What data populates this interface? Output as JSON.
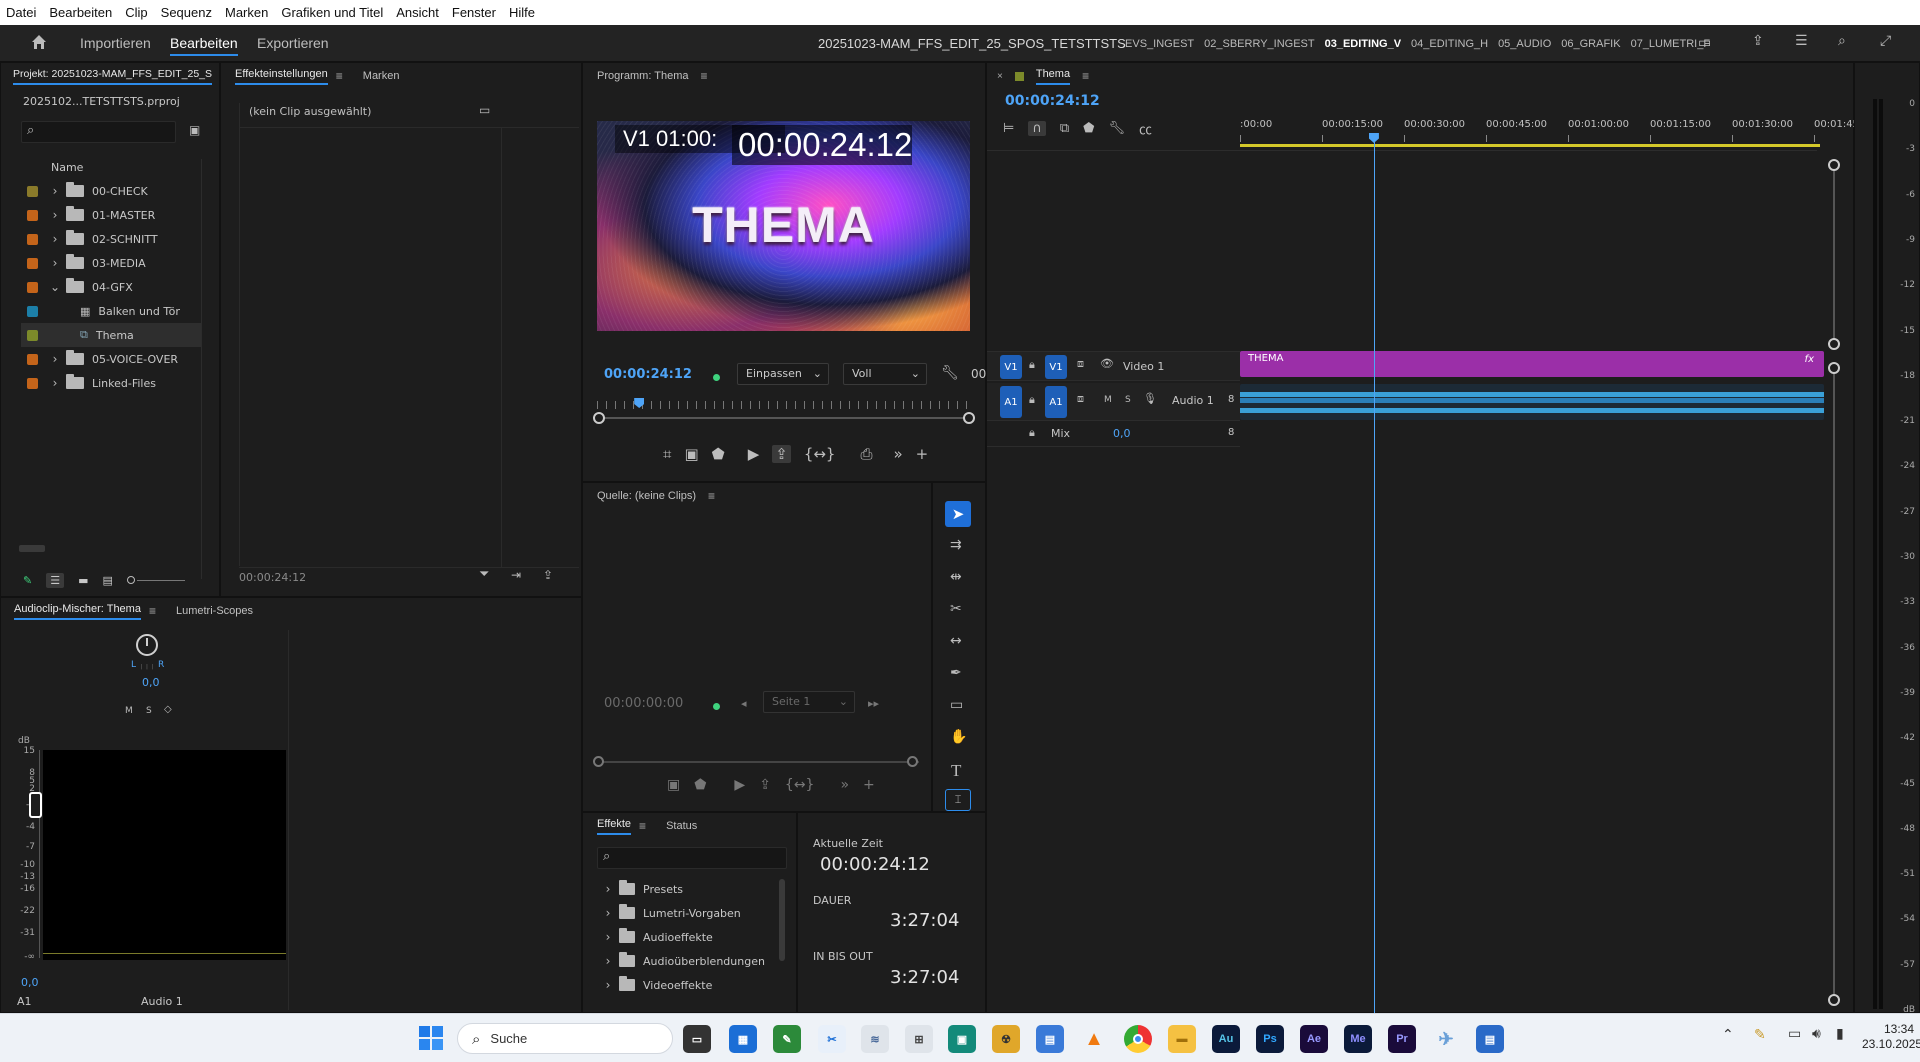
{
  "menu": [
    "Datei",
    "Bearbeiten",
    "Clip",
    "Sequenz",
    "Marken",
    "Grafiken und Titel",
    "Ansicht",
    "Fenster",
    "Hilfe"
  ],
  "workspace": {
    "buttons": [
      "Importieren",
      "Bearbeiten",
      "Exportieren"
    ],
    "active": "Bearbeiten",
    "sequence_title": "20251023-MAM_FFS_EDIT_25_SPOS_TETSTTSTS",
    "tabs": [
      ".EVS_INGEST",
      "02_SBERRY_INGEST",
      "03_EDITING_V",
      "04_EDITING_H",
      "05_AUDIO",
      "06_GRAFIK",
      "07_LUMETRI_F"
    ],
    "active_tab": "03_EDITING_V"
  },
  "project": {
    "title": "Projekt: 20251023-MAM_FFS_EDIT_25_S",
    "file": "2025102...TETSTTSTS.prproj",
    "column_name": "Name",
    "items": [
      {
        "label": "00-CHECK",
        "color": "#8a7a2a",
        "type": "folder",
        "expanded": false,
        "indent": 0
      },
      {
        "label": "01-MASTER",
        "color": "#c4641a",
        "type": "folder",
        "expanded": false,
        "indent": 0
      },
      {
        "label": "02-SCHNITT",
        "color": "#c4641a",
        "type": "folder",
        "expanded": false,
        "indent": 0
      },
      {
        "label": "03-MEDIA",
        "color": "#c4641a",
        "type": "folder",
        "expanded": false,
        "indent": 0
      },
      {
        "label": "04-GFX",
        "color": "#c4641a",
        "type": "folder",
        "expanded": true,
        "indent": 0
      },
      {
        "label": "Balken und Töne",
        "color": "#1c7fa8",
        "type": "bars",
        "expanded": false,
        "indent": 1
      },
      {
        "label": "Thema",
        "color": "#7c8a2a",
        "type": "sequence",
        "expanded": false,
        "indent": 1
      },
      {
        "label": "05-VOICE-OVER",
        "color": "#c4641a",
        "type": "folder",
        "expanded": false,
        "indent": 0
      },
      {
        "label": "Linked-Files",
        "color": "#c4641a",
        "type": "folder",
        "expanded": false,
        "indent": 0
      }
    ]
  },
  "effect_controls": {
    "tab1": "Effekteinstellungen",
    "tab2": "Marken",
    "empty": "(kein Clip ausgewählt)",
    "timecode": "00:00:24:12"
  },
  "program": {
    "title": "Programm: Thema",
    "overlay_left": "V1 01:00:",
    "overlay_tc": "00:00:24:12",
    "frame_text": "THEMA",
    "timecode": "00:00:24:12",
    "fit": "Einpassen",
    "quality": "Voll",
    "extra": "00",
    "playhead_fraction": 0.1
  },
  "source": {
    "title": "Quelle: (keine Clips)",
    "timecode": "00:00:00:00",
    "page": "Seite 1"
  },
  "effects": {
    "tab1": "Effekte",
    "tab2": "Status",
    "items": [
      "Presets",
      "Lumetri-Vorgaben",
      "Audioeffekte",
      "Audioüberblendungen",
      "Videoeffekte"
    ]
  },
  "info": {
    "current_label": "Aktuelle Zeit",
    "current": "00:00:24:12",
    "duration_label": "DAUER",
    "duration": "3:27:04",
    "inout_label": "IN BIS OUT",
    "inout": "3:27:04"
  },
  "mixer": {
    "tab1": "Audioclip-Mischer: Thema",
    "tab2": "Lumetri-Scopes",
    "pan_l": "L",
    "pan_r": "R",
    "pan_value": "0,0",
    "m": "M",
    "s": "S",
    "db_label": "dB",
    "scale": [
      "15",
      "8",
      "5",
      "2",
      "0",
      "-1",
      "-4",
      "-7",
      "-10",
      "-13",
      "-16",
      "-22",
      "-31",
      "-∞"
    ],
    "value": "0,0",
    "channel": "A1",
    "track_name": "Audio 1"
  },
  "timeline": {
    "title": "Thema",
    "timecode": "00:00:24:12",
    "ruler": [
      ":00:00",
      "00:00:15:00",
      "00:00:30:00",
      "00:00:45:00",
      "00:01:00:00",
      "00:01:15:00",
      "00:01:30:00",
      "00:01:45:"
    ],
    "video_track": {
      "src": "V1",
      "tgt": "V1",
      "name": "Video 1",
      "clip": "THEMA",
      "fx": "fx"
    },
    "audio_track": {
      "src": "A1",
      "tgt": "A1",
      "m": "M",
      "s": "S",
      "name": "Audio 1",
      "vol": "8"
    },
    "mix": {
      "label": "Mix",
      "value": "0,0",
      "vol": "8"
    },
    "playhead_seconds": 24.5
  },
  "meter_scale": [
    "0",
    "-3",
    "-6",
    "-9",
    "-12",
    "-15",
    "-18",
    "-21",
    "-24",
    "-27",
    "-30",
    "-33",
    "-36",
    "-39",
    "-42",
    "-45",
    "-48",
    "-51",
    "-54",
    "-57",
    "dB"
  ],
  "taskbar": {
    "search": "Suche",
    "time": "13:34",
    "date": "23.10.2025",
    "apps": [
      "Au",
      "Ps",
      "Ae",
      "Me",
      "Pr"
    ]
  },
  "colors": {
    "accent": "#2d8ceb",
    "clip_video": "#9b2fa8",
    "clip_audio": "#3aa0d8",
    "timecode_blue": "#4ea4f7"
  }
}
